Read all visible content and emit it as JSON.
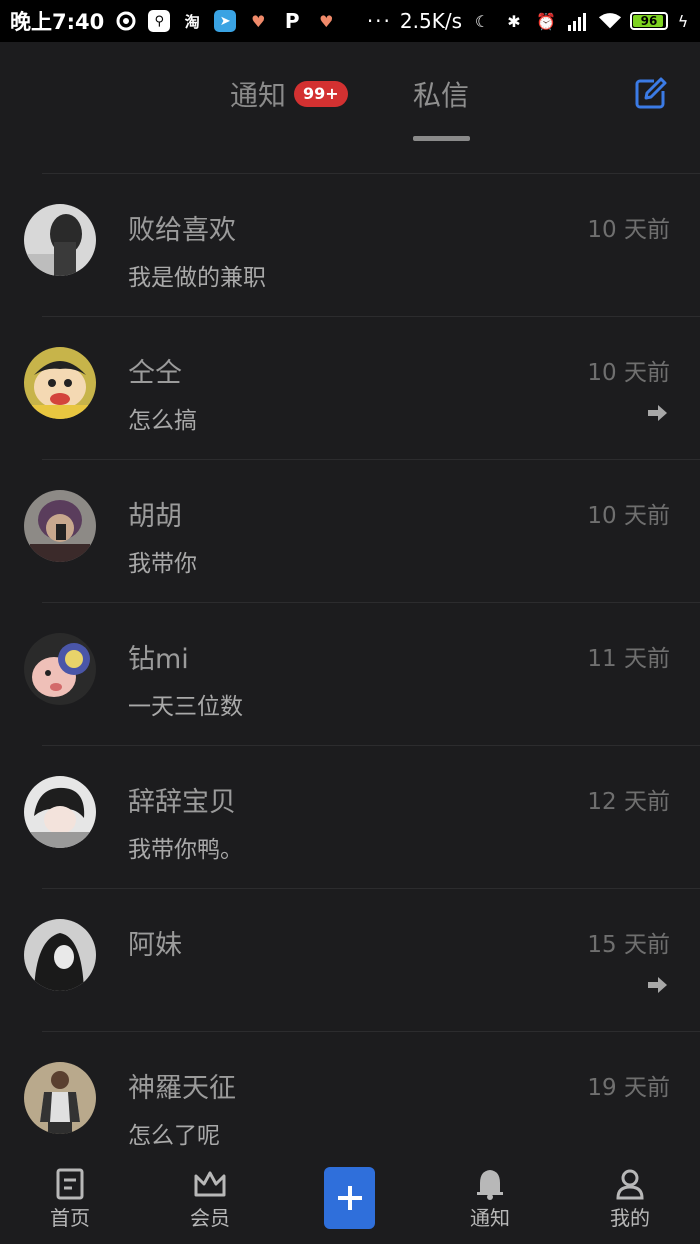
{
  "status_bar": {
    "time": "晚上7:40",
    "network_speed": "2.5K/s",
    "battery_level": "96",
    "icons": [
      "sync-icon",
      "usb-icon",
      "taobao-icon",
      "telegram-icon",
      "heart-icon",
      "p-icon",
      "heart-icon",
      "more-icon",
      "moon-icon",
      "bluetooth-icon",
      "alarm-icon",
      "signal-icon",
      "wifi-icon",
      "battery-icon",
      "charging-icon"
    ]
  },
  "header": {
    "tabs": [
      {
        "label": "通知",
        "badge": "99+"
      },
      {
        "label": "私信"
      }
    ],
    "compose_icon": "edit-icon"
  },
  "conversations": [
    {
      "name": "败给喜欢",
      "message": "我是做的兼职",
      "time": "10 天前",
      "forwarded": false
    },
    {
      "name": "仝仝",
      "message": "怎么搞",
      "time": "10 天前",
      "forwarded": true
    },
    {
      "name": "胡胡",
      "message": "我带你",
      "time": "10 天前",
      "forwarded": false
    },
    {
      "name": "钻mi",
      "message": "一天三位数",
      "time": "11 天前",
      "forwarded": false
    },
    {
      "name": "辞辞宝贝",
      "message": "我带你鸭。",
      "time": "12 天前",
      "forwarded": false
    },
    {
      "name": "阿妹",
      "message": "",
      "time": "15 天前",
      "forwarded": true
    },
    {
      "name": "神羅天征",
      "message": "怎么了呢",
      "time": "19 天前",
      "forwarded": false
    }
  ],
  "bottom_nav": [
    {
      "label": "首页",
      "icon": "home-icon"
    },
    {
      "label": "会员",
      "icon": "crown-icon"
    },
    {
      "label": "",
      "icon": "plus-icon"
    },
    {
      "label": "通知",
      "icon": "bell-icon"
    },
    {
      "label": "我的",
      "icon": "user-icon"
    }
  ],
  "colors": {
    "accent": "#2f6fdb",
    "badge": "#d33131",
    "background": "#1c1c1e"
  }
}
